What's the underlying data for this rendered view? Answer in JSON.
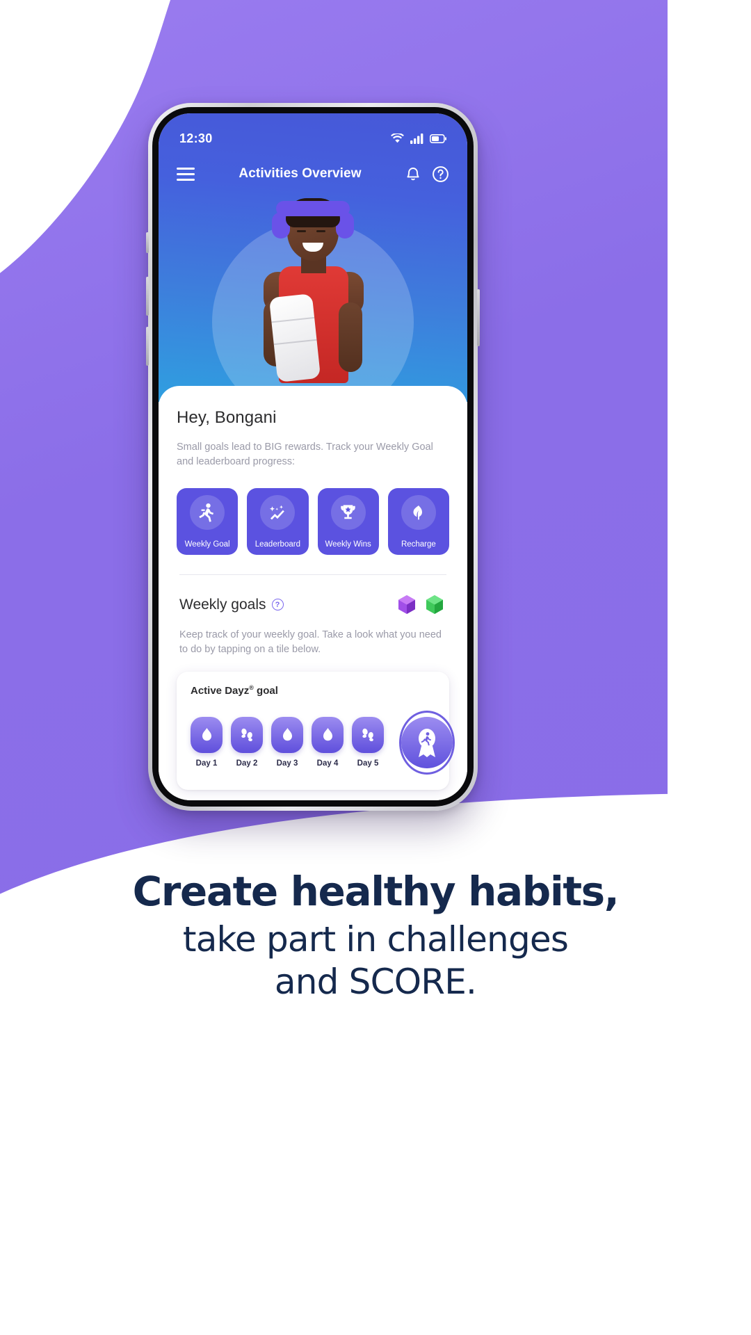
{
  "background": {
    "brand_purple": "#8b6ee8",
    "white": "#ffffff"
  },
  "phone": {
    "statusbar": {
      "time": "12:30",
      "icons": [
        "wifi-icon",
        "cellular-signal-icon",
        "battery-icon"
      ]
    },
    "navbar": {
      "menu_icon": "hamburger-menu-icon",
      "title": "Activities Overview",
      "notification_icon": "bell-icon",
      "help_icon": "question-circle-icon"
    },
    "hero": {
      "image_alt": "smiling athlete in red vest with towel and headphones",
      "accent_top": "#4758d8",
      "accent_bottom": "#2f9fe0"
    },
    "sheet": {
      "greeting": "Hey, Bongani",
      "sub_copy": "Small goals lead to BIG rewards. Track your Weekly Goal and leaderboard progress:",
      "tiles": [
        {
          "label": "Weekly Goal",
          "icon": "runner-icon"
        },
        {
          "label": "Leaderboard",
          "icon": "sparkle-chart-icon"
        },
        {
          "label": "Weekly Wins",
          "icon": "trophy-icon"
        },
        {
          "label": "Recharge",
          "icon": "leaf-icon"
        }
      ],
      "tile_color": "#5b52e0",
      "section": {
        "title": "Weekly goals",
        "help_icon": "question-circle-icon",
        "help_glyph": "?",
        "gems": [
          {
            "name": "purple-gem-icon",
            "color": "#9b4fe0"
          },
          {
            "name": "green-gem-icon",
            "color": "#4fd36a"
          }
        ],
        "copy": "Keep track of your weekly goal. Take a look what you need to do by tapping on a tile below."
      },
      "goal_card": {
        "title": "Active Dayz",
        "title_sup": "®",
        "title_tail": " goal",
        "days": [
          {
            "label": "Day 1",
            "icon": "flame-icon"
          },
          {
            "label": "Day 2",
            "icon": "footsteps-icon"
          },
          {
            "label": "Day 3",
            "icon": "flame-icon"
          },
          {
            "label": "Day 4",
            "icon": "flame-icon"
          },
          {
            "label": "Day 5",
            "icon": "footsteps-icon"
          }
        ],
        "medal": {
          "name": "award-medal-icon"
        }
      }
    }
  },
  "headline": {
    "line1": "Create healthy habits,",
    "line2": "take part in challenges",
    "line3": "and SCORE.",
    "color": "#15294d"
  }
}
